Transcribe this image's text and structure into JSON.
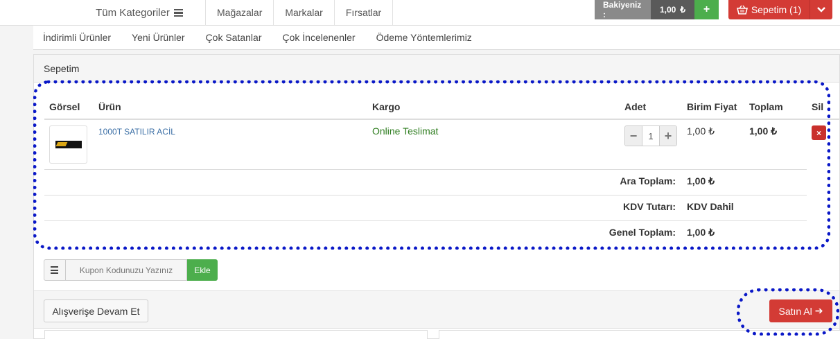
{
  "topbar": {
    "categories_label": "Tüm Kategoriler",
    "nav": [
      "Mağazalar",
      "Markalar",
      "Fırsatlar"
    ],
    "balance_label": "Bakiyeniz :",
    "balance_value": "1,00",
    "currency": "₺",
    "add_balance": "+",
    "cart_label": "Sepetim (1)"
  },
  "subnav": [
    "İndirimli Ürünler",
    "Yeni Ürünler",
    "Çok Satanlar",
    "Çok İncelenenler",
    "Ödeme Yöntemlerimiz"
  ],
  "cart": {
    "title": "Sepetim",
    "columns": {
      "image": "Görsel",
      "product": "Ürün",
      "cargo": "Kargo",
      "qty": "Adet",
      "unit_price": "Birim Fiyat",
      "total": "Toplam",
      "remove": "Sil"
    },
    "items": [
      {
        "product": "1000T SATILIR ACİL",
        "cargo": "Online Teslimat",
        "qty": "1",
        "qty_minus": "−",
        "qty_plus": "+",
        "unit_price": "1,00 ₺",
        "total": "1,00 ₺",
        "remove": "×"
      }
    ],
    "subtotal_label": "Ara Toplam:",
    "subtotal_value": "1,00 ₺",
    "tax_label": "KDV Tutarı:",
    "tax_value": "KDV Dahil",
    "grand_label": "Genel Toplam:",
    "grand_value": "1,00 ₺"
  },
  "coupon": {
    "placeholder": "Kupon Kodunuzu Yazınız",
    "apply_label": "Ekle"
  },
  "actions": {
    "continue_label": "Alışverişe Devam Et",
    "buy_label": "Satın Al",
    "buy_arrow": "➔"
  },
  "colors": {
    "annotation": "#0a18c7",
    "primary_red": "#d33b35",
    "green": "#4cae4c",
    "link": "#3a6ea5",
    "cargo_green": "#2e7d1f"
  }
}
